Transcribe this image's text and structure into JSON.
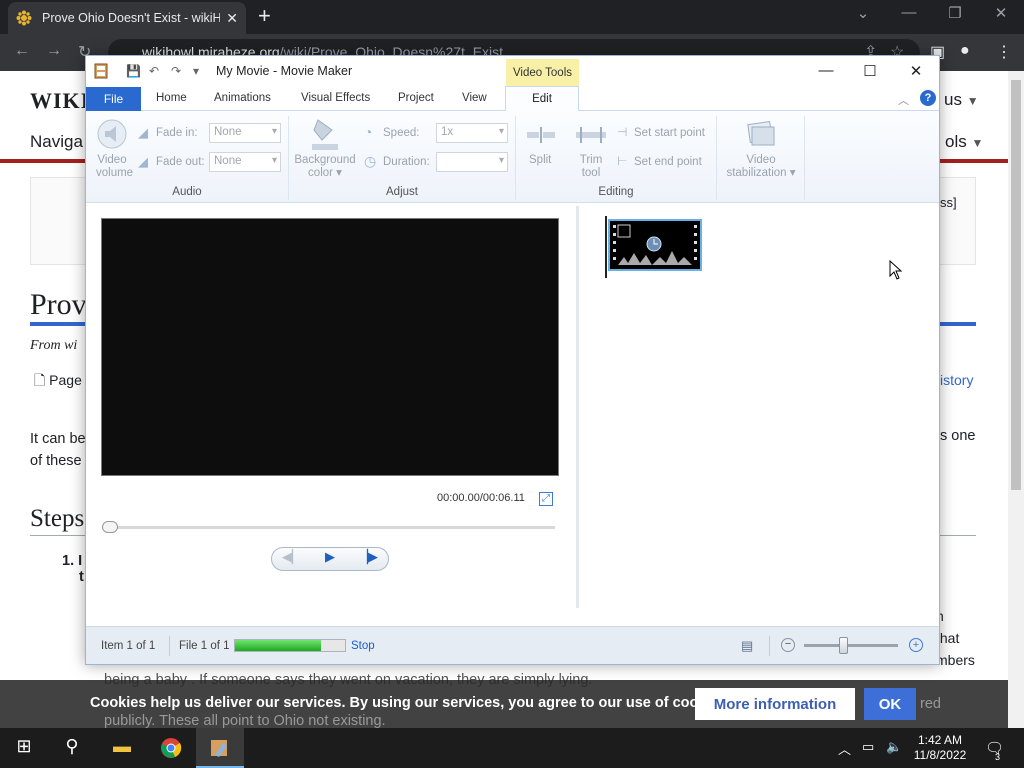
{
  "browser": {
    "tab_title": "Prove Ohio Doesn't Exist - wikiHo",
    "url_host": "wikihowl.miraheze.org",
    "url_path": "/wiki/Prove_Ohio_Doesn%27t_Exist"
  },
  "page": {
    "logo": "WIKI",
    "lang": "us",
    "nav_left": "Naviga",
    "nav_right": "ols",
    "notice_end": "ss]",
    "title": "Prove",
    "from": "From wi",
    "page_tab": "Page",
    "history": "istory",
    "intro_l1": "It can be",
    "intro_l2": "of these",
    "intro_r1": "s one",
    "steps": "Steps",
    "step1_prefix": "1. I",
    "step1_t": "t",
    "right_1": "n",
    "right_2": "that",
    "right_3": "mbers",
    "baby_line": "being a baby . If someone says they went on vacation, they are simply lying.",
    "faint_right": "red",
    "faint_line": "publicly. These all point to Ohio not existing."
  },
  "cookie": {
    "text": "Cookies help us deliver our services. By using our services, you agree to our use of cookies.",
    "more_info": "More information",
    "ok": "OK"
  },
  "moviemaker": {
    "title": "My Movie - Movie Maker",
    "context_tab": "Video Tools",
    "tabs": [
      "File",
      "Home",
      "Animations",
      "Visual Effects",
      "Project",
      "View",
      "Edit"
    ],
    "ribbon": {
      "video_volume": [
        "Video",
        "volume"
      ],
      "fade_in_label": "Fade in:",
      "fade_in_value": "None",
      "fade_out_label": "Fade out:",
      "fade_out_value": "None",
      "audio_group": "Audio",
      "bg_color": [
        "Background",
        "color ▾"
      ],
      "speed_label": "Speed:",
      "speed_value": "1x",
      "duration_label": "Duration:",
      "adjust_group": "Adjust",
      "split": "Split",
      "trim_tool": [
        "Trim",
        "tool"
      ],
      "set_start": "Set start point",
      "set_end": "Set end point",
      "editing_group": "Editing",
      "stabilization": [
        "Video",
        "stabilization ▾"
      ]
    },
    "time": "00:00.00/00:06.11",
    "status": {
      "item": "Item 1 of 1",
      "file": "File 1 of 1",
      "stop": "Stop",
      "progress": 0.78
    }
  },
  "taskbar": {
    "time": "1:42 AM",
    "date": "11/8/2022",
    "notifications": "3"
  }
}
